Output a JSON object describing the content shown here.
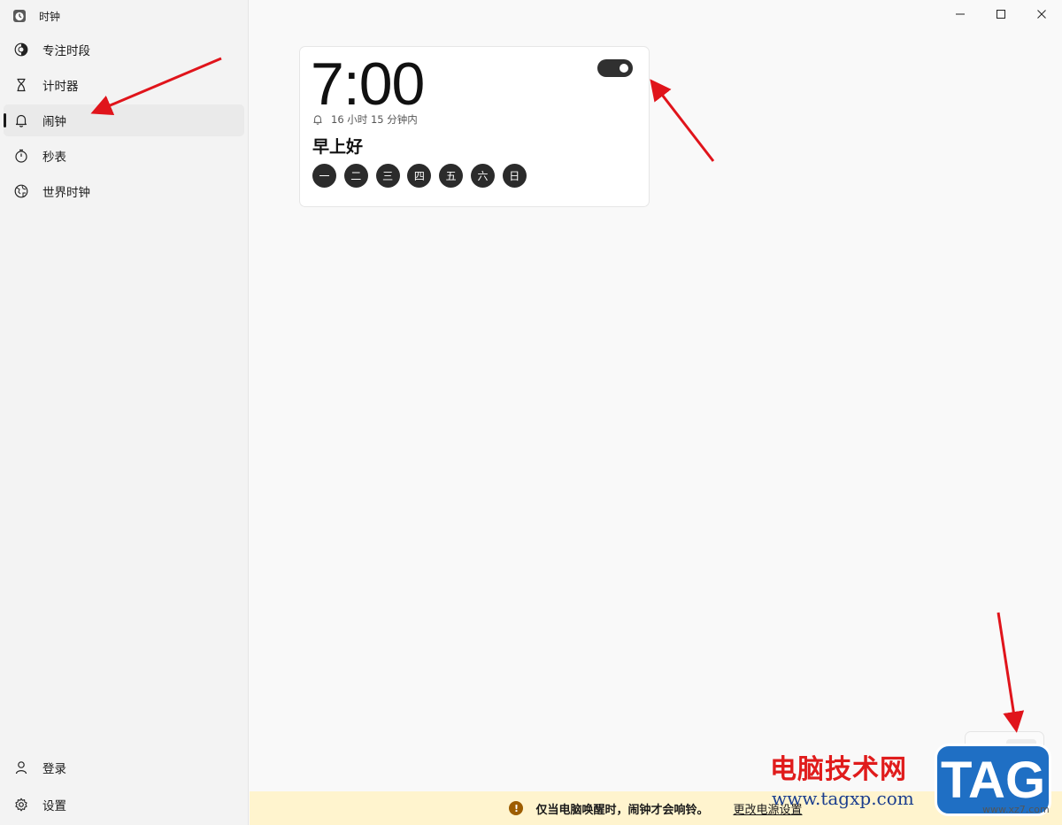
{
  "app": {
    "title": "时钟"
  },
  "sidebar": {
    "items": [
      {
        "label": "专注时段",
        "icon": "focus-icon"
      },
      {
        "label": "计时器",
        "icon": "hourglass-icon"
      },
      {
        "label": "闹钟",
        "icon": "bell-icon",
        "active": true
      },
      {
        "label": "秒表",
        "icon": "stopwatch-icon"
      },
      {
        "label": "世界时钟",
        "icon": "globe-icon"
      }
    ],
    "footer": [
      {
        "label": "登录",
        "icon": "person-icon"
      },
      {
        "label": "设置",
        "icon": "gear-icon"
      }
    ]
  },
  "alarm": {
    "time": "7:00",
    "remaining": "16 小时 15 分钟内",
    "name": "早上好",
    "enabled": true,
    "days": [
      "一",
      "二",
      "三",
      "四",
      "五",
      "六",
      "日"
    ]
  },
  "info_bar": {
    "message": "仅当电脑唤醒时，闹钟才会响铃。",
    "link": "更改电源设置",
    "color": "#fff4ce"
  },
  "watermark": {
    "site_name": "电脑技术网",
    "url": "www.tagxp.com",
    "badge": "TAG",
    "small": "www.xz7.com"
  },
  "colors": {
    "arrow": "#e0141b",
    "accent_dark": "#2b2b2b"
  }
}
